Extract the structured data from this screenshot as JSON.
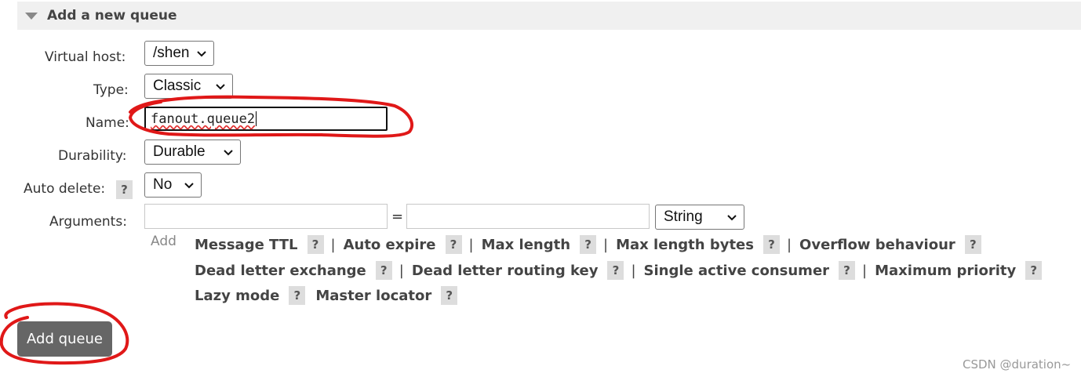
{
  "section": {
    "title": "Add a new queue"
  },
  "form": {
    "virtual_host": {
      "label": "Virtual host:",
      "value": "/shen"
    },
    "type": {
      "label": "Type:",
      "value": "Classic"
    },
    "name": {
      "label": "Name:",
      "value": "fanout.queue2"
    },
    "durability": {
      "label": "Durability:",
      "value": "Durable"
    },
    "auto_delete": {
      "label": "Auto delete:",
      "help": "?",
      "value": "No"
    },
    "arguments": {
      "label": "Arguments:",
      "key_value": "",
      "equals": "=",
      "value_value": "",
      "type_value": "String",
      "add_label": "Add",
      "separator": "|",
      "help": "?",
      "links": [
        {
          "label": "Message TTL"
        },
        {
          "label": "Auto expire"
        },
        {
          "label": "Max length"
        },
        {
          "label": "Max length bytes"
        },
        {
          "label": "Overflow behaviour"
        },
        {
          "label": "Dead letter exchange"
        },
        {
          "label": "Dead letter routing key"
        },
        {
          "label": "Single active consumer"
        },
        {
          "label": "Maximum priority"
        },
        {
          "label": "Lazy mode"
        },
        {
          "label": "Master locator"
        }
      ]
    }
  },
  "submit": {
    "label": "Add queue"
  },
  "watermark": "CSDN @duration~",
  "colors": {
    "annotation": "#e01818",
    "button": "#666666",
    "header_bg": "#f0f0f0"
  }
}
